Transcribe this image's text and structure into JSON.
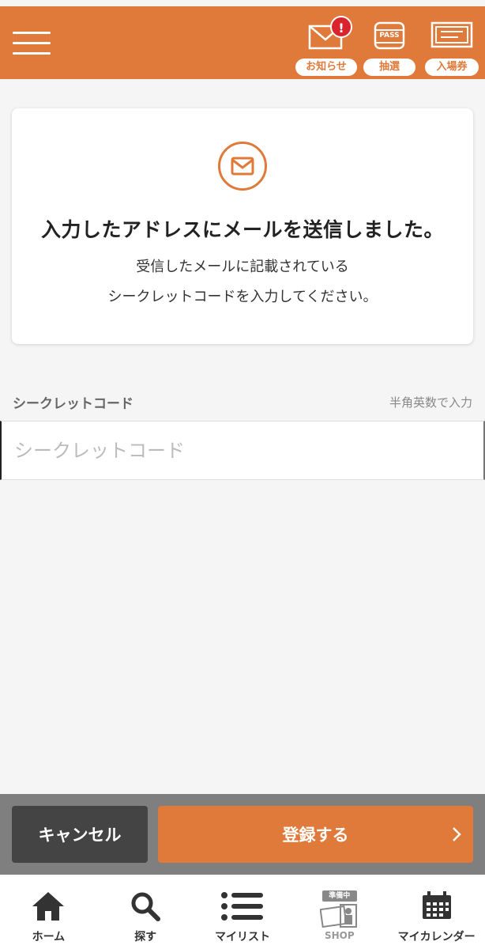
{
  "header": {
    "notice_label": "お知らせ",
    "notice_badge": "!",
    "lottery_label": "抽選",
    "lottery_icon_text": "PASS",
    "ticket_label": "入場券"
  },
  "card": {
    "title": "入力したアドレスにメールを送信しました。",
    "desc_line1": "受信したメールに記載されている",
    "desc_line2": "シークレットコードを入力してください。"
  },
  "field": {
    "label": "シークレットコード",
    "hint": "半角英数で入力",
    "placeholder": "シークレットコード",
    "value": ""
  },
  "actions": {
    "cancel_label": "キャンセル",
    "submit_label": "登録する"
  },
  "bottom_nav": {
    "items": [
      {
        "label": "ホーム",
        "icon": "home-icon"
      },
      {
        "label": "探す",
        "icon": "search-icon"
      },
      {
        "label": "マイリスト",
        "icon": "list-icon"
      },
      {
        "label": "SHOP",
        "icon": "shop-icon",
        "badge": "準備中"
      },
      {
        "label": "マイカレンダー",
        "icon": "calendar-icon"
      }
    ]
  },
  "colors": {
    "accent": "#e07a3a",
    "badge": "#d9232d",
    "cancel": "#444444"
  }
}
